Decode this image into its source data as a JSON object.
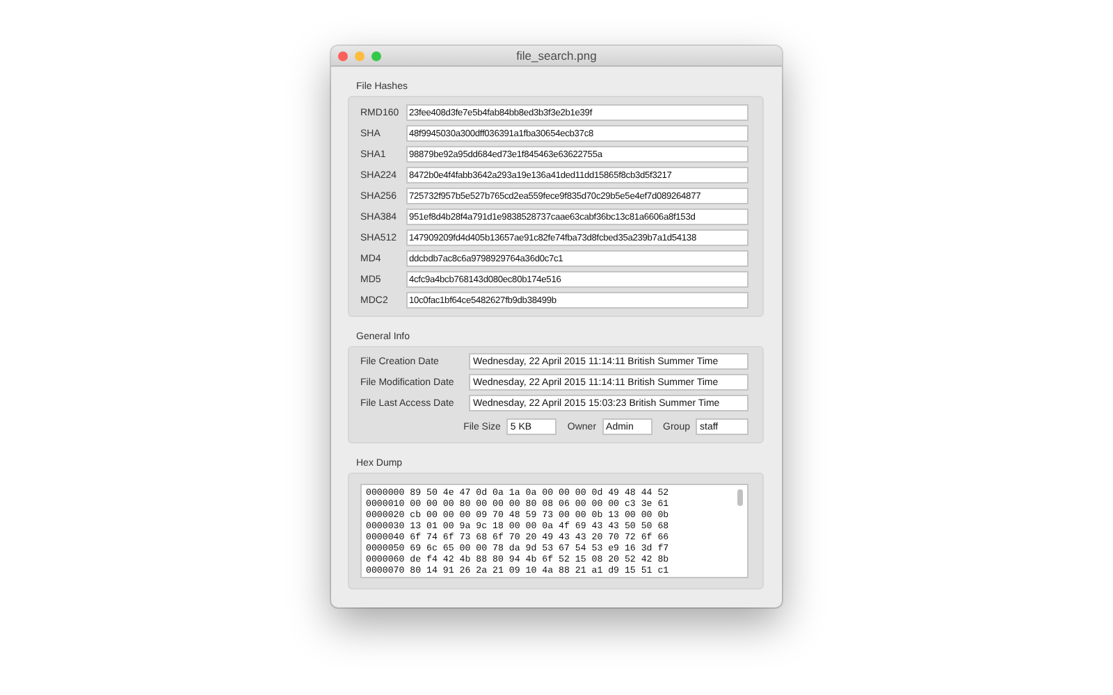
{
  "window": {
    "title": "file_search.png"
  },
  "file_hashes": {
    "title": "File Hashes",
    "rows": [
      {
        "label": "RMD160",
        "value": "23fee408d3fe7e5b4fab84bb8ed3b3f3e2b1e39f"
      },
      {
        "label": "SHA",
        "value": "48f9945030a300dff036391a1fba30654ecb37c8"
      },
      {
        "label": "SHA1",
        "value": "98879be92a95dd684ed73e1f845463e63622755a"
      },
      {
        "label": "SHA224",
        "value": "8472b0e4f4fabb3642a293a19e136a41ded11dd15865f8cb3d5f3217"
      },
      {
        "label": "SHA256",
        "value": "725732f957b5e527b765cd2ea559fece9f835d70c29b5e5e4ef7d089264877"
      },
      {
        "label": "SHA384",
        "value": "951ef8d4b28f4a791d1e9838528737caae63cabf36bc13c81a6606a8f153d"
      },
      {
        "label": "SHA512",
        "value": "147909209fd4d405b13657ae91c82fe74fba73d8fcbed35a239b7a1d54138"
      },
      {
        "label": "MD4",
        "value": "ddcbdb7ac8c6a9798929764a36d0c7c1"
      },
      {
        "label": "MD5",
        "value": "4cfc9a4bcb768143d080ec80b174e516"
      },
      {
        "label": "MDC2",
        "value": "10c0fac1bf64ce5482627fb9db38499b"
      }
    ]
  },
  "general_info": {
    "title": "General Info",
    "dates": [
      {
        "label": "File Creation Date",
        "value": "Wednesday, 22 April 2015 11:14:11 British Summer Time"
      },
      {
        "label": "File Modification Date",
        "value": "Wednesday, 22 April 2015 11:14:11 British Summer Time"
      },
      {
        "label": "File Last Access Date",
        "value": "Wednesday, 22 April 2015 15:03:23 British Summer Time"
      }
    ],
    "attributes": [
      {
        "label": "File Size",
        "value": "5 KB"
      },
      {
        "label": "Owner",
        "value": "Admin"
      },
      {
        "label": "Group",
        "value": "staff"
      }
    ]
  },
  "hex_dump": {
    "title": "Hex Dump",
    "lines": [
      "0000000 89 50 4e 47 0d 0a 1a 0a 00 00 00 0d 49 48 44 52",
      "0000010 00 00 00 80 00 00 00 80 08 06 00 00 00 c3 3e 61",
      "0000020 cb 00 00 00 09 70 48 59 73 00 00 0b 13 00 00 0b",
      "0000030 13 01 00 9a 9c 18 00 00 0a 4f 69 43 43 50 50 68",
      "0000040 6f 74 6f 73 68 6f 70 20 49 43 43 20 70 72 6f 66",
      "0000050 69 6c 65 00 00 78 da 9d 53 67 54 53 e9 16 3d f7",
      "0000060 de f4 42 4b 88 80 94 4b 6f 52 15 08 20 52 42 8b",
      "0000070 80 14 91 26 2a 21 09 10 4a 88 21 a1 d9 15 51 c1"
    ]
  }
}
